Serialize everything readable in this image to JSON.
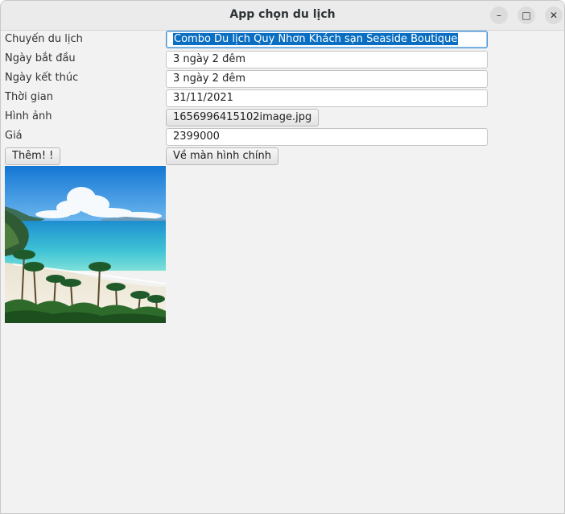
{
  "window": {
    "title": "App chọn du lịch",
    "controls": {
      "minimize": "–",
      "maximize": "□",
      "close": "✕"
    }
  },
  "form": {
    "rows": [
      {
        "label": "Chuyến du lịch",
        "value": "Combo Du lịch Quy Nhơn Khách sạn Seaside Boutique"
      },
      {
        "label": "Ngày bắt đầu",
        "value": "3 ngày 2 đêm"
      },
      {
        "label": "Ngày kết thúc",
        "value": "3 ngày 2 đêm"
      },
      {
        "label": "Thời gian",
        "value": "31/11/2021"
      },
      {
        "label": "Hình ảnh",
        "value": "1656996415102image.jpg"
      },
      {
        "label": "Giá",
        "value": "2399000"
      }
    ],
    "add_button": "Thêm! !",
    "home_button": "Về màn hình chính"
  },
  "colors": {
    "selection": "#0a6fc2",
    "focus_border": "#3d8fd1",
    "window_bg": "#f2f2f2"
  }
}
